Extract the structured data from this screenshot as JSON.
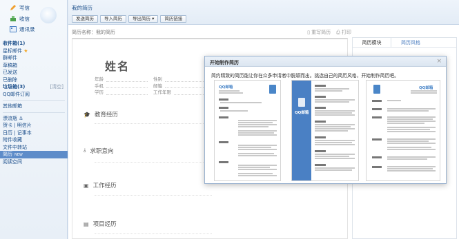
{
  "sidebar": {
    "write": "写信",
    "receive": "收信",
    "contacts": "通讯录",
    "items": [
      {
        "label": "收件箱(1)",
        "bold": true
      },
      {
        "label": "星标邮件",
        "star": "★"
      },
      {
        "label": "群邮件"
      },
      {
        "label": "草稿箱"
      },
      {
        "label": "已发送"
      },
      {
        "label": "已删除"
      },
      {
        "label": "垃圾箱(3)",
        "side": "[清空]",
        "bold": true
      },
      {
        "label": "QQ邮件订阅"
      }
    ],
    "other": "其他邮箱",
    "tools": [
      {
        "label": "漂流瓶 ⚓"
      },
      {
        "label": "贺卡 | 明信片"
      },
      {
        "label": "日历 | 记事本"
      },
      {
        "label": "附件收藏"
      },
      {
        "label": "文件中转站"
      },
      {
        "label": "简历",
        "tag": "NEW",
        "active": true
      },
      {
        "label": "阅读空间"
      }
    ]
  },
  "header": {
    "title": "我的简历",
    "buttons": [
      "发送简历",
      "导入简历",
      "导出简历 ▾",
      "简历链接"
    ]
  },
  "doc": {
    "name_label": "简历名称：我的简历",
    "rewrite": "重写简历",
    "print": "打印"
  },
  "resume": {
    "name": "姓名",
    "fields": [
      [
        "年龄",
        "性别"
      ],
      [
        "手机",
        "邮箱"
      ],
      [
        "学历",
        "工作年限"
      ]
    ],
    "sections": [
      "教育经历",
      "求职意向",
      "工作经历",
      "项目经历"
    ]
  },
  "panel": {
    "tab_module": "简历模块",
    "tab_style": "简历风格"
  },
  "modal": {
    "title": "开始制作简历",
    "close": "×",
    "desc": "简约精致的简历能让你在众多申请者中脱颖而出。挑选自己的简历风格，开始制作简历吧。",
    "brand": "QQ邮箱"
  },
  "colors": {
    "link": "#1b4e8a",
    "active": "#5d8cc9",
    "brand": "#4a86c8"
  }
}
